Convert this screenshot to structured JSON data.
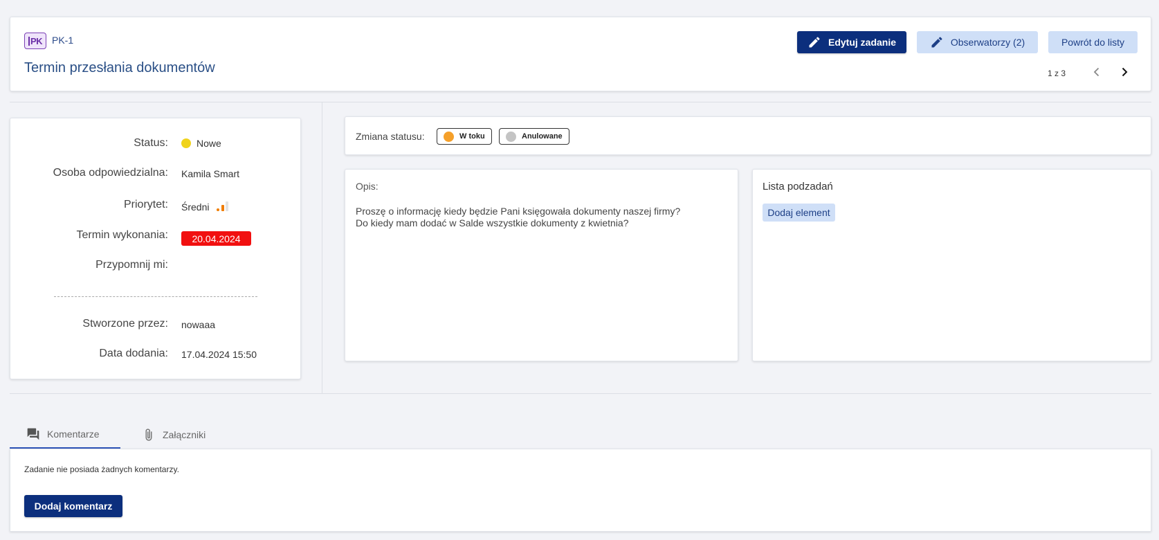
{
  "header": {
    "badge": "PK",
    "code": "PK-1",
    "title": "Termin przesłania dokumentów",
    "buttons": {
      "edit": "Edytuj zadanie",
      "observers": "Obserwatorzy (2)",
      "back": "Powrót do listy"
    },
    "pager": "1 z 3"
  },
  "details": {
    "status_label": "Status:",
    "status_value": "Nowe",
    "owner_label": "Osoba odpowiedzialna:",
    "owner_value": "Kamila Smart",
    "priority_label": "Priorytet:",
    "priority_value": "Średni",
    "priority_level": 2,
    "priority_max": 3,
    "deadline_label": "Termin wykonania:",
    "deadline_value": "20.04.2024",
    "reminder_label": "Przypomnij mi:",
    "created_by_label": "Stworzone przez:",
    "created_by_value": "nowaaa",
    "added_label": "Data dodania:",
    "added_value": "17.04.2024 15:50"
  },
  "status_change": {
    "label": "Zmiana statusu:",
    "options": [
      {
        "label": "W toku",
        "color": "#f5a02a"
      },
      {
        "label": "Anulowane",
        "color": "#c4c4c4"
      }
    ]
  },
  "description": {
    "label": "Opis:",
    "line1": "Proszę o informację kiedy będzie Pani księgowała dokumenty naszej firmy?",
    "line2": "Do kiedy mam dodać w Salde wszystkie dokumenty z kwietnia?"
  },
  "subtasks": {
    "title": "Lista podzadań",
    "add_button": "Dodaj element"
  },
  "tabs": {
    "comments": "Komentarze",
    "attachments": "Załączniki"
  },
  "comments": {
    "empty_text": "Zadanie nie posiada żadnych komentarzy.",
    "add_button": "Dodaj komentarz"
  },
  "colors": {
    "primary": "#0c2f7d",
    "light_button": "#cfdff7",
    "status_new": "#f0d31b",
    "deadline": "#f11010",
    "tab_active": "#2e53b8"
  }
}
